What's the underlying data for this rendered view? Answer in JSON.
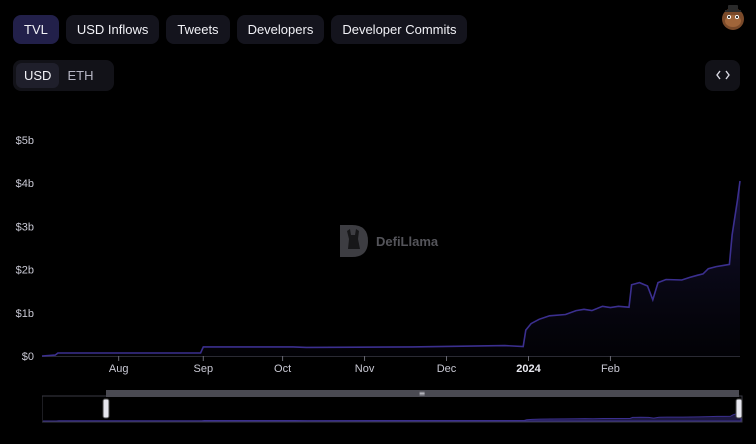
{
  "tabs": [
    {
      "label": "TVL",
      "active": true
    },
    {
      "label": "USD Inflows",
      "active": false
    },
    {
      "label": "Tweets",
      "active": false
    },
    {
      "label": "Developers",
      "active": false
    },
    {
      "label": "Developer Commits",
      "active": false
    }
  ],
  "currency": {
    "usd_label": "USD",
    "eth_label": "ETH",
    "selected": "USD"
  },
  "embed_icon": "code-icon",
  "avatar_icon": "llama-avatar-icon",
  "watermark": {
    "text": "DefiLlama",
    "icon": "defillama-logo-icon"
  },
  "colors": {
    "line": "#3b2f8f",
    "fill": "#1a1640",
    "tab_active": "#22204a",
    "background": "#000000"
  },
  "chart_data": {
    "type": "area",
    "ylim": [
      0,
      5
    ],
    "y_ticks": [
      "$0",
      "$1b",
      "$2b",
      "$3b",
      "$4b",
      "$5b"
    ],
    "x_ticks": [
      "Aug",
      "Sep",
      "Oct",
      "Nov",
      "Dec",
      "2024",
      "Feb"
    ],
    "x_unit": "days since start of visible range",
    "y_unit": "billions USD",
    "series": [
      {
        "points": [
          [
            0,
            0.0
          ],
          [
            5,
            0.02
          ],
          [
            6,
            0.07
          ],
          [
            60,
            0.07
          ],
          [
            61,
            0.21
          ],
          [
            95,
            0.21
          ],
          [
            100,
            0.2
          ],
          [
            140,
            0.21
          ],
          [
            175,
            0.24
          ],
          [
            182,
            0.22
          ],
          [
            183,
            0.6
          ],
          [
            185,
            0.75
          ],
          [
            188,
            0.85
          ],
          [
            192,
            0.93
          ],
          [
            198,
            0.96
          ],
          [
            202,
            1.05
          ],
          [
            205,
            1.08
          ],
          [
            208,
            1.05
          ],
          [
            212,
            1.15
          ],
          [
            215,
            1.12
          ],
          [
            218,
            1.15
          ],
          [
            222,
            1.13
          ],
          [
            223,
            1.65
          ],
          [
            226,
            1.7
          ],
          [
            229,
            1.62
          ],
          [
            231,
            1.3
          ],
          [
            233,
            1.7
          ],
          [
            236,
            1.77
          ],
          [
            242,
            1.76
          ],
          [
            245,
            1.82
          ],
          [
            248,
            1.87
          ],
          [
            250,
            1.9
          ],
          [
            252,
            2.02
          ],
          [
            255,
            2.07
          ],
          [
            258,
            2.1
          ],
          [
            260,
            2.12
          ],
          [
            261,
            2.8
          ],
          [
            263,
            3.6
          ],
          [
            264,
            4.05
          ]
        ]
      }
    ],
    "x_range": [
      0,
      264
    ],
    "x_tick_days": [
      29,
      61,
      91,
      122,
      153,
      184,
      215
    ],
    "grid": false,
    "legend": "none"
  },
  "brush": {
    "handle_label": "≡"
  }
}
